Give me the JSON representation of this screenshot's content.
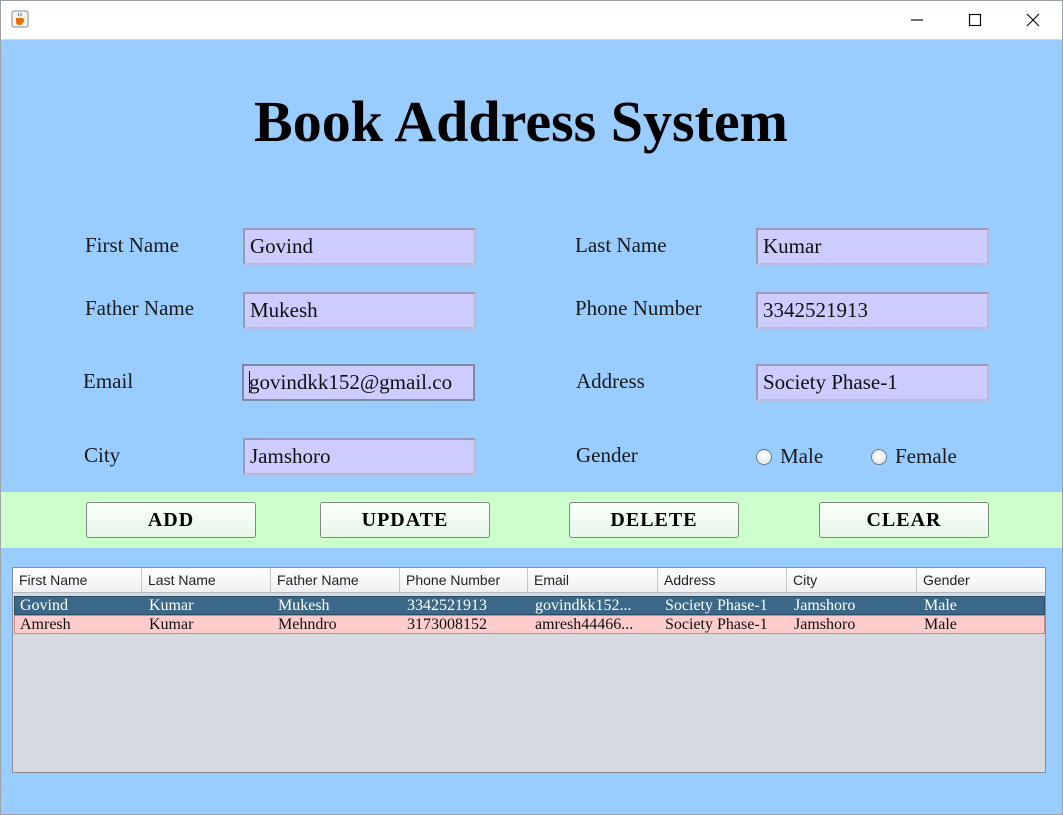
{
  "window": {
    "app_icon": "java-cup-icon",
    "controls": [
      "minimize-icon",
      "maximize-icon",
      "close-icon"
    ]
  },
  "title": "Book Address System",
  "form": {
    "first_name": {
      "label": "First Name",
      "value": "Govind"
    },
    "last_name": {
      "label": "Last Name",
      "value": "Kumar"
    },
    "father_name": {
      "label": "Father Name",
      "value": "Mukesh"
    },
    "phone_number": {
      "label": "Phone Number",
      "value": "3342521913"
    },
    "email": {
      "label": "Email",
      "value": "govindkk152@gmail.co"
    },
    "address": {
      "label": "Address",
      "value": "Society Phase-1"
    },
    "city": {
      "label": "City",
      "value": "Jamshoro"
    },
    "gender": {
      "label": "Gender",
      "options": [
        "Male",
        "Female"
      ],
      "selected": null
    }
  },
  "buttons": {
    "add": "ADD",
    "update": "UPDATE",
    "delete": "DELETE",
    "clear": "CLEAR"
  },
  "colors": {
    "background": "#99ccff",
    "field_bg": "#ccccff",
    "button_bar": "#ccffcc",
    "selected_row": "#3c6888",
    "alt_row": "#ffcccc"
  },
  "table": {
    "columns": [
      "First Name",
      "Last Name",
      "Father Name",
      "Phone Number",
      "Email",
      "Address",
      "City",
      "Gender"
    ],
    "rows": [
      [
        "Govind",
        "Kumar",
        "Mukesh",
        "3342521913",
        "govindkk152...",
        "Society Phase-1",
        "Jamshoro",
        "Male"
      ],
      [
        "Amresh",
        "Kumar",
        "Mehndro",
        "3173008152",
        "amresh44466...",
        "Society Phase-1",
        "Jamshoro",
        "Male"
      ]
    ],
    "selected_row": 0
  }
}
